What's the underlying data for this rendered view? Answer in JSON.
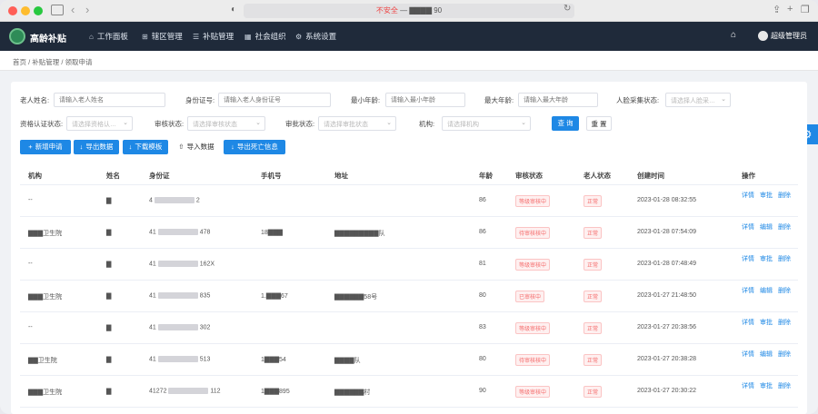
{
  "browser": {
    "url_warning": "不安全",
    "url_host": "— ▇▇▇▇ 90"
  },
  "app": {
    "name": "高龄补贴",
    "user": "超级管理员"
  },
  "nav": [
    {
      "label": "工作面板",
      "icon": "⌂"
    },
    {
      "label": "辖区管理",
      "icon": "⊞"
    },
    {
      "label": "补贴管理",
      "icon": "☰"
    },
    {
      "label": "社会组织",
      "icon": "▦"
    },
    {
      "label": "系统设置",
      "icon": "⚙"
    }
  ],
  "breadcrumb": "首页 / 补贴管理 / 领取申请",
  "filters": {
    "name_label": "老人姓名:",
    "name_placeholder": "请输入老人姓名",
    "id_label": "身份证号:",
    "id_placeholder": "请输入老人身份证号",
    "min_age_label": "最小年龄:",
    "min_age_placeholder": "请输入最小年龄",
    "max_age_label": "最大年龄:",
    "max_age_placeholder": "请输入最大年龄",
    "elder_status_label": "人脸采集状态:",
    "elder_status_placeholder": "请选择人脸采…",
    "auth_label": "资格认证状态:",
    "auth_placeholder": "请选择资格认…",
    "audit_label": "审核状态:",
    "audit_placeholder": "请选择审核状态",
    "review_label": "审批状态:",
    "review_placeholder": "请选择审批状态",
    "org_label": "机构:",
    "org_placeholder": "请选择机构",
    "query": "查 询",
    "reset": "重 置"
  },
  "actions": [
    {
      "label": "新增申请",
      "icon": "+"
    },
    {
      "label": "导出数据",
      "icon": "↓"
    },
    {
      "label": "下载模板",
      "icon": "↓"
    },
    {
      "label": "导入数据",
      "icon": "⇧"
    },
    {
      "label": "导出死亡信息",
      "icon": "↓"
    }
  ],
  "table": {
    "headers": [
      "机构",
      "姓名",
      "身份证",
      "手机号",
      "地址",
      "年龄",
      "审核状态",
      "老人状态",
      "创建时间",
      "操作"
    ],
    "rows": [
      {
        "org": "--",
        "name": "▇",
        "id_pre": "4",
        "id_suf": "2",
        "phone": "",
        "addr": "",
        "age": "86",
        "audit": "等级审核中",
        "state": "正常",
        "time": "2023-01-28 08:32:55",
        "ops": [
          "详情",
          "审批",
          "删除"
        ]
      },
      {
        "org": "▇▇▇卫生院",
        "name": "▇",
        "id_pre": "41",
        "id_suf": "478",
        "phone": "18▇▇▇",
        "addr": "▇▇▇▇▇▇▇▇▇队",
        "age": "86",
        "audit": "待审核核中",
        "state": "正常",
        "time": "2023-01-28 07:54:09",
        "ops": [
          "详情",
          "编辑",
          "删除"
        ]
      },
      {
        "org": "--",
        "name": "▇",
        "id_pre": "41",
        "id_suf": "162X",
        "phone": "",
        "addr": "",
        "age": "81",
        "audit": "等级审核中",
        "state": "正常",
        "time": "2023-01-28 07:48:49",
        "ops": [
          "详情",
          "审批",
          "删除"
        ]
      },
      {
        "org": "▇▇▇卫生院",
        "name": "▇",
        "id_pre": "41",
        "id_suf": "835",
        "phone": "1.▇▇▇67",
        "addr": "▇▇▇▇▇▇58号",
        "age": "80",
        "audit": "已审核中",
        "state": "正常",
        "time": "2023-01-27 21:48:50",
        "ops": [
          "详情",
          "编辑",
          "删除"
        ]
      },
      {
        "org": "--",
        "name": "▇",
        "id_pre": "41",
        "id_suf": "302",
        "phone": "",
        "addr": "",
        "age": "83",
        "audit": "等级审核中",
        "state": "正常",
        "time": "2023-01-27 20:38:56",
        "ops": [
          "详情",
          "审批",
          "删除"
        ]
      },
      {
        "org": "▇▇卫生院",
        "name": "▇",
        "id_pre": "41",
        "id_suf": "513",
        "phone": "1▇▇▇54",
        "addr": "▇▇▇▇队",
        "age": "80",
        "audit": "待审核核中",
        "state": "正常",
        "time": "2023-01-27 20:38:28",
        "ops": [
          "详情",
          "编辑",
          "删除"
        ]
      },
      {
        "org": "▇▇▇卫生院",
        "name": "▇",
        "id_pre": "41272",
        "id_suf": "112",
        "phone": "1▇▇▇895",
        "addr": "▇▇▇▇▇▇村",
        "age": "90",
        "audit": "等级审核中",
        "state": "正常",
        "time": "2023-01-27 20:30:22",
        "ops": [
          "详情",
          "审批",
          "删除"
        ]
      }
    ]
  }
}
